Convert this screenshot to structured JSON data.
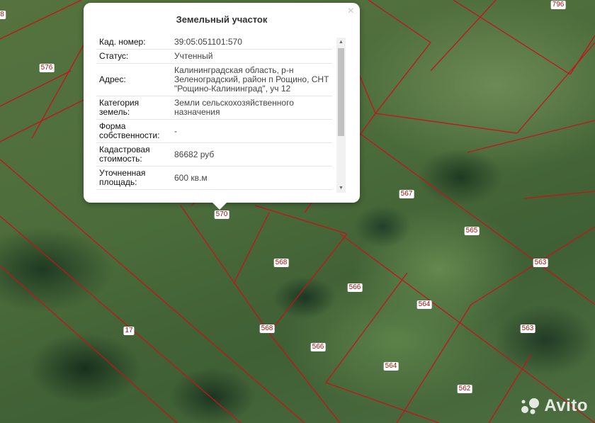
{
  "popup": {
    "title": "Земельный участок",
    "close": "×",
    "rows": [
      {
        "label": "Кад. номер:",
        "value": "39:05:051101:570"
      },
      {
        "label": "Статус:",
        "value": "Учтенный"
      },
      {
        "label": "Адрес:",
        "value": "Калининградская область, р-н Зеленоградский, район п Рощино, СНТ \"Рощино-Калининград\", уч 12"
      },
      {
        "label": "Категория земель:",
        "value": "Земли сельскохозяйственного назначения"
      },
      {
        "label": "Форма собственности:",
        "value": "-"
      },
      {
        "label": "Кадастровая стоимость:",
        "value": "86682 руб"
      },
      {
        "label": "Уточненная площадь:",
        "value": "600 кв.м"
      }
    ]
  },
  "map": {
    "labels": [
      "8",
      "576",
      "796",
      "570",
      "567",
      "565",
      "568",
      "563",
      "566",
      "564",
      "17",
      "568",
      "563",
      "566",
      "564",
      "562"
    ],
    "boundary_color": "#c0161c"
  },
  "watermark": {
    "text": "Avito"
  }
}
